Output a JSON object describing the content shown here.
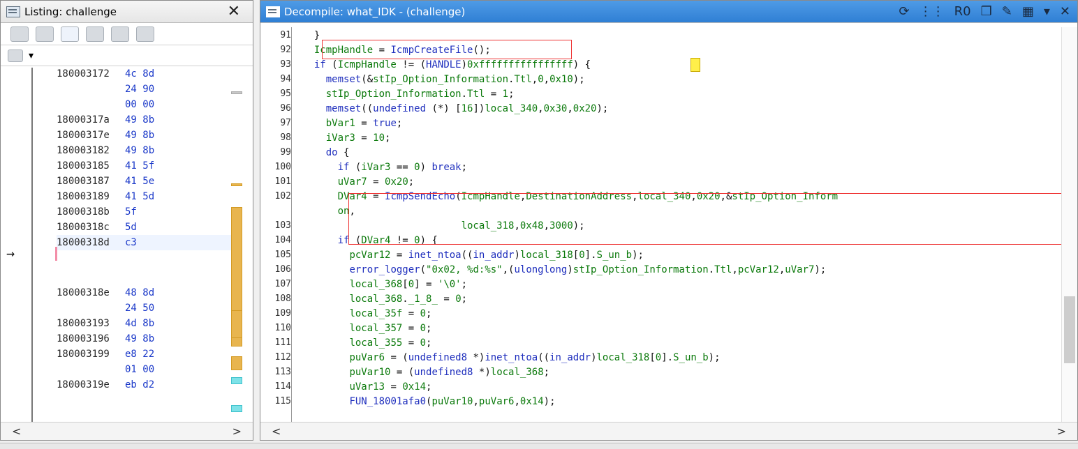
{
  "listing": {
    "title": "Listing:  challenge",
    "rows": [
      {
        "addr": "180003172",
        "bytes": "4c 8d"
      },
      {
        "addr": "",
        "bytes": "24 90"
      },
      {
        "addr": "",
        "bytes": "00 00"
      },
      {
        "addr": "18000317a",
        "bytes": "49 8b"
      },
      {
        "addr": "18000317e",
        "bytes": "49 8b"
      },
      {
        "addr": "180003182",
        "bytes": "49 8b"
      },
      {
        "addr": "180003185",
        "bytes": "41 5f"
      },
      {
        "addr": "180003187",
        "bytes": "41 5e"
      },
      {
        "addr": "180003189",
        "bytes": "41 5d"
      },
      {
        "addr": "18000318b",
        "bytes": "5f"
      },
      {
        "addr": "18000318c",
        "bytes": "5d"
      },
      {
        "addr": "18000318d",
        "bytes": "c3"
      },
      {
        "addr": "18000318e",
        "bytes": "48 8d"
      },
      {
        "addr": "",
        "bytes": "24 50"
      },
      {
        "addr": "180003193",
        "bytes": "4d 8b"
      },
      {
        "addr": "180003196",
        "bytes": "49 8b"
      },
      {
        "addr": "180003199",
        "bytes": "e8 22"
      },
      {
        "addr": "",
        "bytes": "01 00"
      },
      {
        "addr": "18000319e",
        "bytes": "eb d2"
      }
    ]
  },
  "decompile": {
    "title": "Decompile: what_IDK -  (challenge)",
    "lines": [
      {
        "n": "91",
        "t": "  }"
      },
      {
        "n": "92",
        "t": "  IcmpHandle = IcmpCreateFile();"
      },
      {
        "n": "93",
        "t": "  if (IcmpHandle != (HANDLE)0xffffffffffffffff) {"
      },
      {
        "n": "94",
        "t": "    memset(&stIp_Option_Information.Ttl,0,0x10);"
      },
      {
        "n": "95",
        "t": "    stIp_Option_Information.Ttl = 1;"
      },
      {
        "n": "96",
        "t": "    memset((undefined (*) [16])local_340,0x30,0x20);"
      },
      {
        "n": "97",
        "t": "    bVar1 = true;"
      },
      {
        "n": "98",
        "t": "    iVar3 = 10;"
      },
      {
        "n": "99",
        "t": "    do {"
      },
      {
        "n": "100",
        "t": "      if (iVar3 == 0) break;"
      },
      {
        "n": "101",
        "t": "      uVar7 = 0x20;"
      },
      {
        "n": "102",
        "t": "      DVar4 = IcmpSendEcho(IcmpHandle,DestinationAddress,local_340,0x20,&stIp_Option_Inform"
      },
      {
        "n": "",
        "t": "      on,"
      },
      {
        "n": "103",
        "t": "                           local_318,0x48,3000);"
      },
      {
        "n": "104",
        "t": "      if (DVar4 != 0) {"
      },
      {
        "n": "105",
        "t": "        pcVar12 = inet_ntoa((in_addr)local_318[0].S_un_b);"
      },
      {
        "n": "106",
        "t": "        error_logger(\"0x02, %d:%s\",(ulonglong)stIp_Option_Information.Ttl,pcVar12,uVar7);"
      },
      {
        "n": "107",
        "t": "        local_368[0] = '\\0';"
      },
      {
        "n": "108",
        "t": "        local_368._1_8_ = 0;"
      },
      {
        "n": "109",
        "t": "        local_35f = 0;"
      },
      {
        "n": "110",
        "t": "        local_357 = 0;"
      },
      {
        "n": "111",
        "t": "        local_355 = 0;"
      },
      {
        "n": "112",
        "t": "        puVar6 = (undefined8 *)inet_ntoa((in_addr)local_318[0].S_un_b);"
      },
      {
        "n": "113",
        "t": "        puVar10 = (undefined8 *)local_368;"
      },
      {
        "n": "114",
        "t": "        uVar13 = 0x14;"
      },
      {
        "n": "115",
        "t": "        FUN_18001afa0(puVar10,puVar6,0x14);"
      }
    ]
  },
  "colors": {
    "accent": "#2f7fd4",
    "box": "#e33333",
    "keyword": "#1e2ebd",
    "literal": "#0c7a0c"
  }
}
